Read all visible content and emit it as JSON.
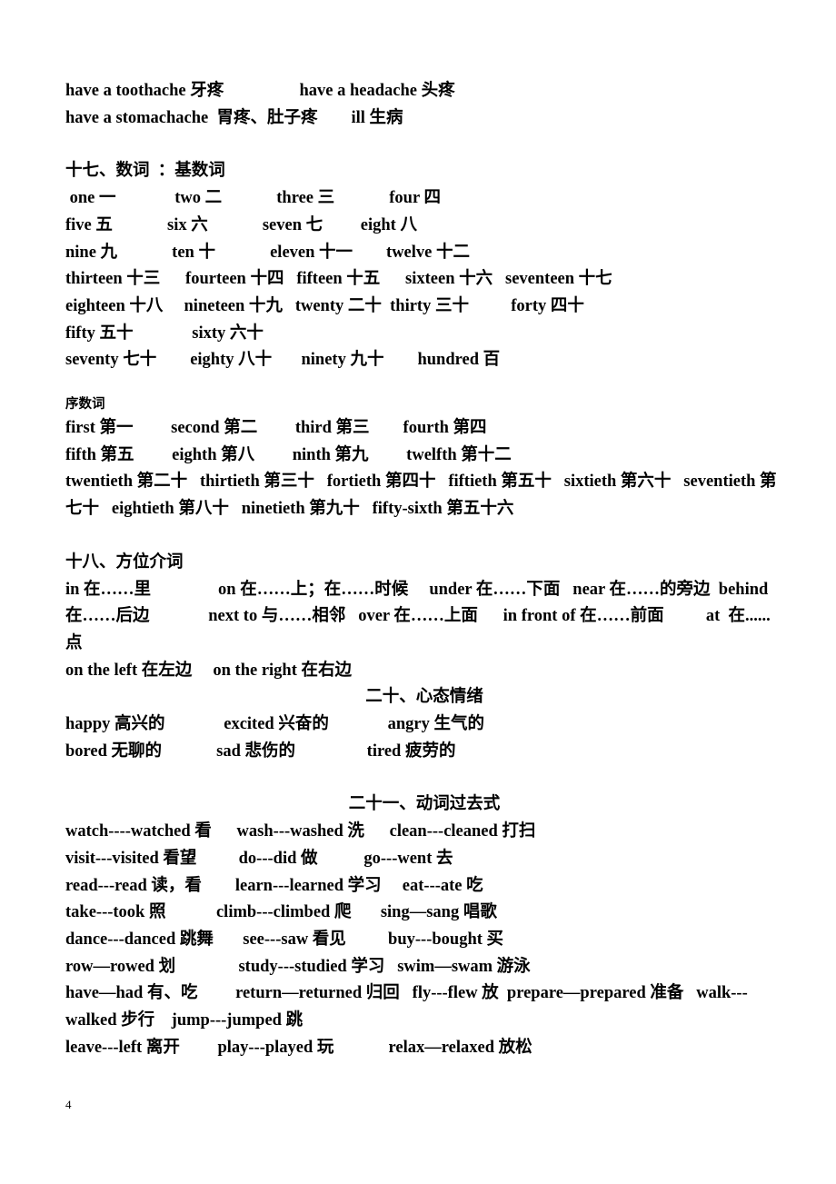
{
  "document": {
    "page_number": "4",
    "language": "zh-CN / en"
  },
  "ailments": {
    "lines": [
      "have a toothache 牙疼                  have a headache 头疼",
      "have a stomachache  胃疼、肚子疼        ill 生病"
    ]
  },
  "numerals_section": {
    "heading": "十七、数词  ：基数词",
    "cardinal_lines": [
      " one 一              two 二             three 三             four 四",
      "five 五             six 六             seven 七         eight 八",
      "nine 九             ten 十             eleven 十一        twelve 十二",
      "thirteen 十三      fourteen 十四   fifteen 十五      sixteen 十六   seventeen 十七",
      "eighteen 十八     nineteen 十九   twenty 二十  thirty 三十          forty 四十",
      "fifty 五十              sixty 六十",
      "seventy 七十        eighty 八十       ninety 九十        hundred 百"
    ],
    "ordinal_heading": "序数词",
    "ordinal_lines": [
      "first 第一         second 第二         third 第三        fourth 第四",
      "fifth 第五         eighth 第八         ninth 第九         twelfth 第十二",
      "twentieth 第二十   thirtieth 第三十   fortieth 第四十   fiftieth 第五十   sixtieth 第六十   seventieth 第七十   eightieth 第八十   ninetieth 第九十   fifty-sixth 第五十六"
    ]
  },
  "prepositions_section": {
    "heading": "十八、方位介词",
    "lines": [
      "in 在……里                on 在……上；在……时候     under 在……下面   near 在……的旁边  behind 在……后边              next to 与……相邻   over 在……上面      in front of 在……前面          at  在......点",
      "on the left 在左边     on the right 在右边"
    ]
  },
  "emotions_section": {
    "heading": "二十、心态情绪",
    "lines": [
      "happy 高兴的              excited 兴奋的              angry 生气的",
      "bored 无聊的             sad 悲伤的                 tired 疲劳的"
    ]
  },
  "past_tense_section": {
    "heading": "二十一、动词过去式",
    "lines": [
      "watch----watched 看      wash---washed 洗      clean---cleaned 打扫",
      "visit---visited 看望          do---did 做           go---went 去",
      "read---read 读，看        learn---learned 学习     eat---ate 吃",
      "take---took 照            climb---climbed 爬       sing—sang 唱歌",
      "dance---danced 跳舞       see---saw 看见          buy---bought 买",
      "row—rowed 划               study---studied 学习   swim—swam 游泳",
      "have—had 有、吃         return—returned 归回   fly---flew 放  prepare—prepared 准备   walk---walked 步行    jump---jumped 跳",
      "leave---left 离开         play---played 玩             relax—relaxed 放松"
    ]
  }
}
